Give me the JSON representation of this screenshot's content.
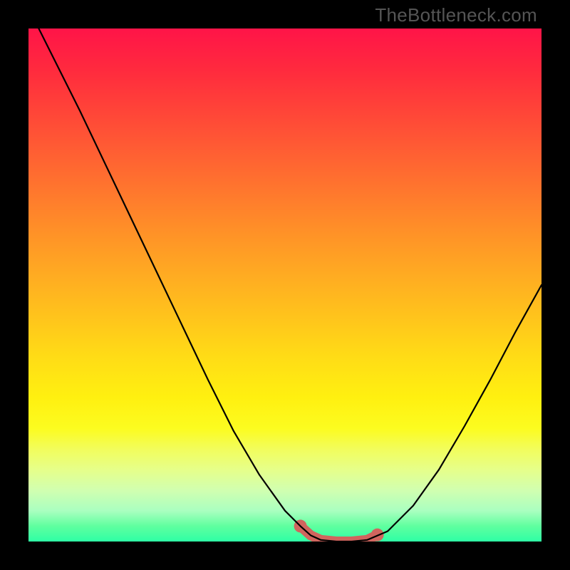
{
  "watermark": "TheBottleneck.com",
  "chart_data": {
    "type": "line",
    "title": "",
    "xlabel": "",
    "ylabel": "",
    "xlim": [
      0,
      100
    ],
    "ylim": [
      0,
      100
    ],
    "series": [
      {
        "name": "curve",
        "color": "#000000",
        "x": [
          2,
          5,
          10,
          15,
          20,
          25,
          30,
          35,
          40,
          45,
          50,
          53,
          55,
          57,
          60,
          63,
          66,
          70,
          75,
          80,
          85,
          90,
          95,
          100
        ],
        "values": [
          100,
          94,
          84,
          73.5,
          63,
          52.5,
          42,
          31.5,
          21.5,
          13,
          6,
          3,
          1.2,
          0.3,
          0,
          0,
          0.3,
          2,
          7,
          14,
          22.5,
          31.5,
          41,
          50
        ]
      },
      {
        "name": "highlight-band",
        "color": "#d0655e",
        "x": [
          53,
          55,
          57,
          60,
          63,
          66,
          68
        ],
        "values": [
          3,
          1.2,
          0.3,
          0,
          0,
          0.3,
          1.3
        ]
      }
    ],
    "annotations": []
  }
}
